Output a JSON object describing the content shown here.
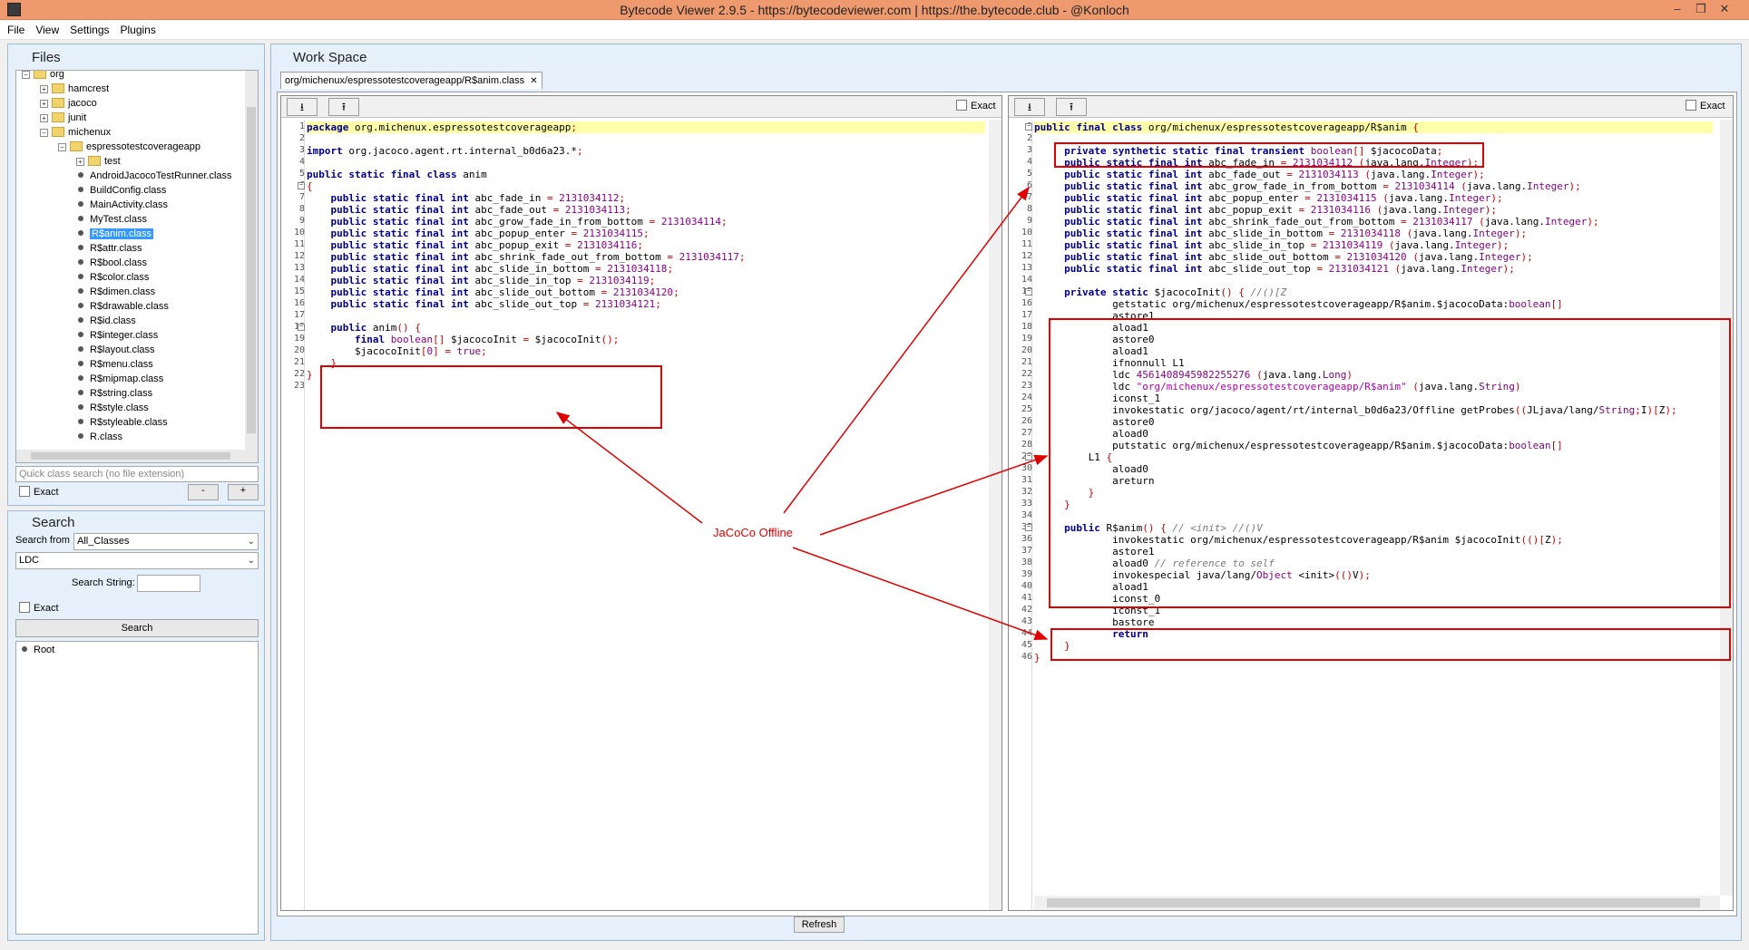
{
  "window": {
    "title": "Bytecode Viewer 2.9.5 - https://bytecodeviewer.com | https://the.bytecode.club - @Konloch",
    "minimize": "–",
    "restore": "❐",
    "close": "✕"
  },
  "menu": [
    "File",
    "View",
    "Settings",
    "Plugins"
  ],
  "files_panel": {
    "title": "Files",
    "tree": [
      {
        "label": "org",
        "indent": 0,
        "type": "folder",
        "expander": "⊟"
      },
      {
        "label": "hamcrest",
        "indent": 1,
        "type": "folder",
        "expander": "⊞"
      },
      {
        "label": "jacoco",
        "indent": 1,
        "type": "folder",
        "expander": "⊞"
      },
      {
        "label": "junit",
        "indent": 1,
        "type": "folder",
        "expander": "⊞"
      },
      {
        "label": "michenux",
        "indent": 1,
        "type": "folder",
        "expander": "⊟"
      },
      {
        "label": "espressotestcoverageapp",
        "indent": 2,
        "type": "folder",
        "expander": "⊟"
      },
      {
        "label": "test",
        "indent": 3,
        "type": "folder",
        "expander": "⊞"
      },
      {
        "label": "AndroidJacocoTestRunner.class",
        "indent": 3,
        "type": "class"
      },
      {
        "label": "BuildConfig.class",
        "indent": 3,
        "type": "class"
      },
      {
        "label": "MainActivity.class",
        "indent": 3,
        "type": "class"
      },
      {
        "label": "MyTest.class",
        "indent": 3,
        "type": "class"
      },
      {
        "label": "R$anim.class",
        "indent": 3,
        "type": "class",
        "selected": true
      },
      {
        "label": "R$attr.class",
        "indent": 3,
        "type": "class"
      },
      {
        "label": "R$bool.class",
        "indent": 3,
        "type": "class"
      },
      {
        "label": "R$color.class",
        "indent": 3,
        "type": "class"
      },
      {
        "label": "R$dimen.class",
        "indent": 3,
        "type": "class"
      },
      {
        "label": "R$drawable.class",
        "indent": 3,
        "type": "class"
      },
      {
        "label": "R$id.class",
        "indent": 3,
        "type": "class"
      },
      {
        "label": "R$integer.class",
        "indent": 3,
        "type": "class"
      },
      {
        "label": "R$layout.class",
        "indent": 3,
        "type": "class"
      },
      {
        "label": "R$menu.class",
        "indent": 3,
        "type": "class"
      },
      {
        "label": "R$mipmap.class",
        "indent": 3,
        "type": "class"
      },
      {
        "label": "R$string.class",
        "indent": 3,
        "type": "class"
      },
      {
        "label": "R$style.class",
        "indent": 3,
        "type": "class"
      },
      {
        "label": "R$styleable.class",
        "indent": 3,
        "type": "class"
      },
      {
        "label": "R.class",
        "indent": 3,
        "type": "class"
      }
    ],
    "quick_search_placeholder": "Quick class search (no file extension)",
    "exact_label": "Exact",
    "minus_label": "-",
    "plus_label": "+"
  },
  "search_panel": {
    "title": "Search",
    "search_from_label": "Search from",
    "search_from_value": "All_Classes",
    "type_value": "LDC",
    "search_string_label": "Search String:",
    "search_string_value": "",
    "exact_label": "Exact",
    "search_button": "Search",
    "results_root": "Root"
  },
  "workspace": {
    "title": "Work Space",
    "tab_label": "org/michenux/espressotestcoverageapp/R$anim.class",
    "tab_close": "✕",
    "exact_label": "Exact",
    "refresh_button": "Refresh",
    "annotation_label": "JaCoCo Offline"
  },
  "left_code": [
    "package org.michenux.espressotestcoverageapp;",
    "",
    "import org.jacoco.agent.rt.internal_b0d6a23.*;",
    "",
    "public static final class anim",
    "{",
    "    public static final int abc_fade_in = 2131034112;",
    "    public static final int abc_fade_out = 2131034113;",
    "    public static final int abc_grow_fade_in_from_bottom = 2131034114;",
    "    public static final int abc_popup_enter = 2131034115;",
    "    public static final int abc_popup_exit = 2131034116;",
    "    public static final int abc_shrink_fade_out_from_bottom = 2131034117;",
    "    public static final int abc_slide_in_bottom = 2131034118;",
    "    public static final int abc_slide_in_top = 2131034119;",
    "    public static final int abc_slide_out_bottom = 2131034120;",
    "    public static final int abc_slide_out_top = 2131034121;",
    "",
    "    public anim() {",
    "        final boolean[] $jacocoInit = $jacocoInit();",
    "        $jacocoInit[0] = true;",
    "    }",
    "}",
    ""
  ],
  "right_code": [
    "public final class org/michenux/espressotestcoverageapp/R$anim {",
    "",
    "     private synthetic static final transient boolean[] $jacocoData;",
    "     public static final int abc_fade_in = 2131034112 (java.lang.Integer);",
    "     public static final int abc_fade_out = 2131034113 (java.lang.Integer);",
    "     public static final int abc_grow_fade_in_from_bottom = 2131034114 (java.lang.Integer);",
    "     public static final int abc_popup_enter = 2131034115 (java.lang.Integer);",
    "     public static final int abc_popup_exit = 2131034116 (java.lang.Integer);",
    "     public static final int abc_shrink_fade_out_from_bottom = 2131034117 (java.lang.Integer);",
    "     public static final int abc_slide_in_bottom = 2131034118 (java.lang.Integer);",
    "     public static final int abc_slide_in_top = 2131034119 (java.lang.Integer);",
    "     public static final int abc_slide_out_bottom = 2131034120 (java.lang.Integer);",
    "     public static final int abc_slide_out_top = 2131034121 (java.lang.Integer);",
    "",
    "     private static $jacocoInit() { //()[Z",
    "             getstatic org/michenux/espressotestcoverageapp/R$anim.$jacocoData:boolean[]",
    "             astore1",
    "             aload1",
    "             astore0",
    "             aload1",
    "             ifnonnull L1",
    "             ldc 4561408945982255276 (java.lang.Long)",
    "             ldc \"org/michenux/espressotestcoverageapp/R$anim\" (java.lang.String)",
    "             iconst_1",
    "             invokestatic org/jacoco/agent/rt/internal_b0d6a23/Offline getProbes((JLjava/lang/String;I)[Z);",
    "             astore0",
    "             aload0",
    "             putstatic org/michenux/espressotestcoverageapp/R$anim.$jacocoData:boolean[]",
    "         L1 {",
    "             aload0",
    "             areturn",
    "         }",
    "     }",
    "",
    "     public R$anim() { // <init> //()V",
    "             invokestatic org/michenux/espressotestcoverageapp/R$anim $jacocoInit(()[Z);",
    "             astore1",
    "             aload0 // reference to self",
    "             invokespecial java/lang/Object <init>(()V);",
    "             aload1",
    "             iconst_0",
    "             iconst_1",
    "             bastore",
    "             return",
    "     }",
    "}"
  ],
  "colors": {
    "annotation": "#e00000",
    "selection": "#3399ff",
    "titlebar": "#ee9a6e",
    "highlight": "#ffffaa"
  }
}
